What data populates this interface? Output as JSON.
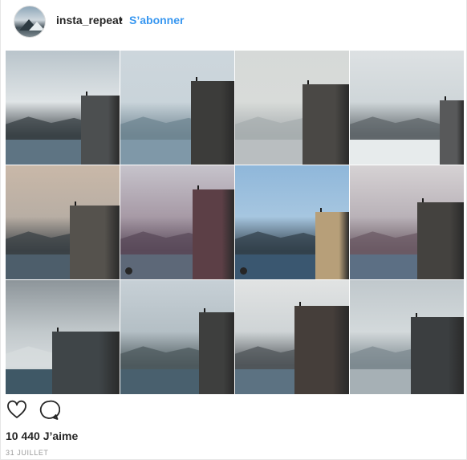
{
  "post": {
    "author": {
      "username": "insta_repeat",
      "separator": "•",
      "follow_label": "S’abonner"
    },
    "image": {
      "grid_rows": 3,
      "grid_cols": 4,
      "tiles": [
        {
          "name": "tile-1",
          "sky": "#b9c4cb",
          "ground": "#3a4146",
          "cliff": "#4c4f50",
          "water": "#5e7483",
          "fog": "#dfe4e6"
        },
        {
          "name": "tile-2",
          "sky": "#cdd6dc",
          "ground": "#6f8592",
          "cliff": "#3c3c3a",
          "water": "#7f98a8",
          "fog": "#c9d4da"
        },
        {
          "name": "tile-3",
          "sky": "#d6d9d8",
          "ground": "#a7adaf",
          "cliff": "#4a4845",
          "water": "#b9bec0",
          "fog": "#d8dbd9"
        },
        {
          "name": "tile-4",
          "sky": "#dde1e3",
          "ground": "#5f666a",
          "cliff": "#58595a",
          "water": "#e7ebec",
          "fog": "#cfd6d9"
        },
        {
          "name": "tile-5",
          "sky": "#c9b8a8",
          "ground": "#3b4146",
          "cliff": "#55524d",
          "water": "#4d5e6b",
          "fog": "#b8aea4"
        },
        {
          "name": "tile-6",
          "sky": "#c6c3cb",
          "ground": "#5a4a5a",
          "cliff": "#5c3f46",
          "water": "#5d6878",
          "fog": "#a79aa6"
        },
        {
          "name": "tile-7",
          "sky": "#8fb7da",
          "ground": "#33414c",
          "cliff": "#b79f79",
          "water": "#3a5770",
          "fog": "#a6c6e0"
        },
        {
          "name": "tile-8",
          "sky": "#d6d2d4",
          "ground": "#6b5a64",
          "cliff": "#44423f",
          "water": "#5c6f84",
          "fog": "#b9b2b8"
        },
        {
          "name": "tile-9",
          "sky": "#8d959a",
          "ground": "#d7dcde",
          "cliff": "#3f4548",
          "water": "#3f5866",
          "fog": "#c1c8cb"
        },
        {
          "name": "tile-10",
          "sky": "#c7d0d6",
          "ground": "#4d5a5e",
          "cliff": "#3e3f3e",
          "water": "#49606e",
          "fog": "#b4bfc5"
        },
        {
          "name": "tile-11",
          "sky": "#e1e3e3",
          "ground": "#50565a",
          "cliff": "#453e3a",
          "water": "#5c7282",
          "fog": "#cfd4d6"
        },
        {
          "name": "tile-12",
          "sky": "#c0c8cc",
          "ground": "#7d8a90",
          "cliff": "#3b3e40",
          "water": "#a6b0b5",
          "fog": "#d3d9db"
        }
      ]
    },
    "actions": {
      "like_icon": "heart-outline-icon",
      "comment_icon": "comment-bubble-icon"
    },
    "likes_text": "10 440 J’aime",
    "date_text": "31 JUILLET",
    "colors": {
      "accent": "#3897f0",
      "text": "#262626",
      "muted": "#999999",
      "border": "#e6e6e6"
    }
  }
}
